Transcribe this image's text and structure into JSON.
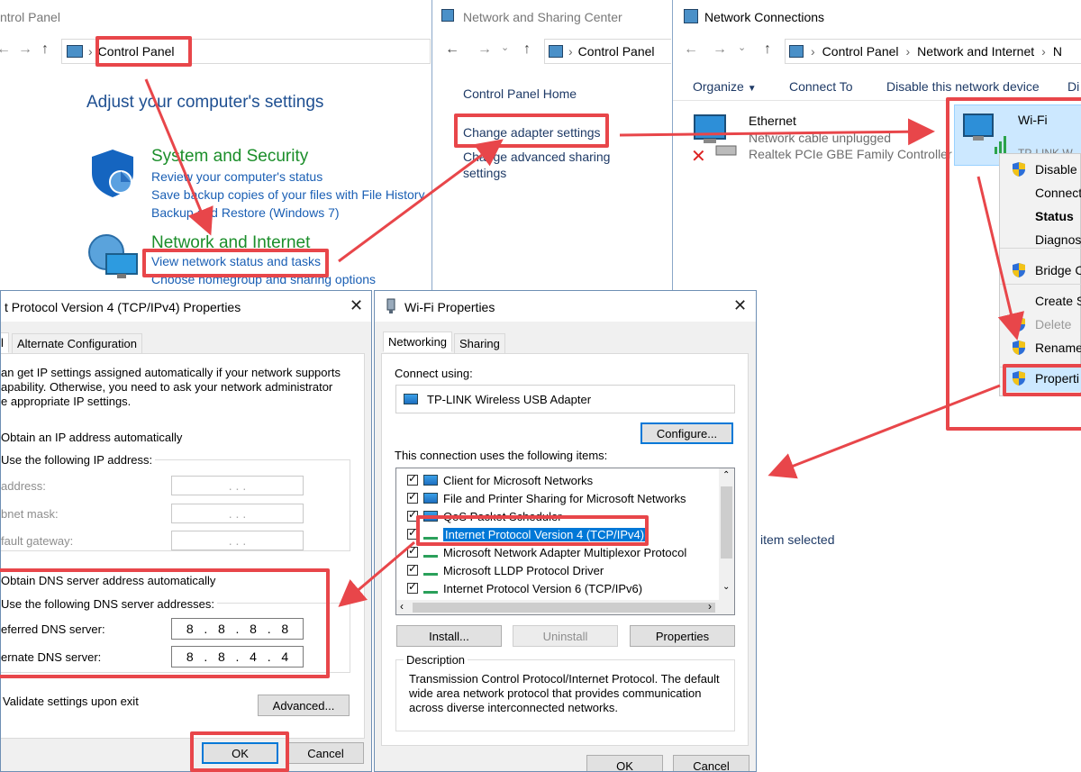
{
  "control_panel": {
    "title": "ntrol Panel",
    "address": "Control Panel",
    "heading": "Adjust your computer's settings",
    "categories": [
      {
        "name": "System and Security",
        "links": [
          "Review your computer's status",
          "Save backup copies of your files with File History",
          "Backup and Restore (Windows 7)"
        ]
      },
      {
        "name": "Network and Internet",
        "links": [
          "View network status and tasks",
          "Choose homegroup and sharing options"
        ]
      }
    ]
  },
  "sharing_center": {
    "title": "Network and Sharing Center",
    "address": "Control Panel",
    "links": [
      "Control Panel Home",
      "Change adapter settings",
      "Change advanced sharing",
      "settings"
    ]
  },
  "network_connections": {
    "title": "Network Connections",
    "breadcrumb": [
      "Control Panel",
      "Network and Internet",
      "N"
    ],
    "toolbar": [
      "Organize",
      "Connect To",
      "Disable this network device",
      "Di"
    ],
    "ethernet": {
      "name": "Ethernet",
      "status": "Network cable unplugged",
      "device": "Realtek PCIe GBE Family Controller"
    },
    "wifi": {
      "name": "Wi-Fi",
      "device": "TP-LINK W"
    },
    "context_menu": [
      "Disable",
      "Connect",
      "Status",
      "Diagnos",
      "Bridge C",
      "Create S",
      "Delete",
      "Rename",
      "Properti"
    ],
    "status_bar": "item selected"
  },
  "ipv4_dialog": {
    "title": "t Protocol Version 4 (TCP/IPv4) Properties",
    "tabs": [
      "l",
      "Alternate Configuration"
    ],
    "intro": [
      "an get IP settings assigned automatically if your network supports",
      "apability. Otherwise, you need to ask your network administrator",
      "e appropriate IP settings."
    ],
    "obtain_ip": "Obtain an IP address automatically",
    "use_ip": "Use the following IP address:",
    "ip_labels": [
      "address:",
      "bnet mask:",
      "fault gateway:"
    ],
    "ip_placeholder": ".   .   .",
    "obtain_dns": "Obtain DNS server address automatically",
    "use_dns": "Use the following DNS server addresses:",
    "dns_labels": [
      "eferred DNS server:",
      "ernate DNS server:"
    ],
    "dns_values": [
      [
        "8",
        "8",
        "8",
        "8"
      ],
      [
        "8",
        "8",
        "4",
        "4"
      ]
    ],
    "validate": "Validate settings upon exit",
    "advanced": "Advanced...",
    "ok": "OK",
    "cancel": "Cancel"
  },
  "wifi_dialog": {
    "title": "Wi-Fi Properties",
    "tabs": [
      "Networking",
      "Sharing"
    ],
    "connect_using_label": "Connect using:",
    "adapter": "TP-LINK Wireless USB Adapter",
    "configure": "Configure...",
    "items_label": "This connection uses the following items:",
    "items": [
      "Client for Microsoft Networks",
      "File and Printer Sharing for Microsoft Networks",
      "QoS Packet Scheduler",
      "Internet Protocol Version 4 (TCP/IPv4)",
      "Microsoft Network Adapter Multiplexor Protocol",
      "Microsoft LLDP Protocol Driver",
      "Internet Protocol Version 6 (TCP/IPv6)"
    ],
    "install": "Install...",
    "uninstall": "Uninstall",
    "properties": "Properties",
    "description_label": "Description",
    "description": [
      "Transmission Control Protocol/Internet Protocol. The default",
      "wide area network protocol that provides communication",
      "across diverse interconnected networks."
    ],
    "ok": "OK",
    "cancel": "Cancel"
  },
  "colors": {
    "annotation": "#e8464a",
    "link": "#1a5fb4",
    "category": "#1b8e2a",
    "selection": "#0078d7"
  }
}
